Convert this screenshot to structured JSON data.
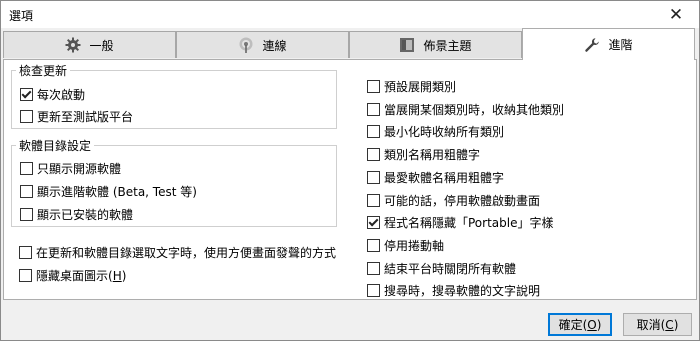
{
  "window": {
    "title": "選項",
    "close_label": "✕"
  },
  "tabs": [
    {
      "label": "一般",
      "icon": "gear-icon"
    },
    {
      "label": "連線",
      "icon": "antenna-icon"
    },
    {
      "label": "佈景主題",
      "icon": "theme-icon"
    },
    {
      "label": "進階",
      "icon": "wrench-icon",
      "active": true
    }
  ],
  "update_group": {
    "title": "檢查更新",
    "items": [
      {
        "label": "每次啟動",
        "checked": true
      },
      {
        "label": "更新至測試版平台",
        "checked": false
      }
    ]
  },
  "catalog_group": {
    "title": "軟體目錄設定",
    "items": [
      {
        "label": "只顯示開源軟體",
        "checked": false
      },
      {
        "label": "顯示進階軟體 (Beta, Test 等)",
        "checked": false
      },
      {
        "label": "顯示已安裝的軟體",
        "checked": false
      }
    ]
  },
  "misc_left": [
    {
      "label": "在更新和軟體目錄選取文字時，使用方便畫面發聲的方式",
      "checked": false
    },
    {
      "label_prefix": "隱藏桌面圖示(",
      "accel": "H",
      "label_suffix": ")",
      "checked": false
    }
  ],
  "right_options": [
    {
      "label": "預設展開類別",
      "checked": false
    },
    {
      "label": "當展開某個類別時，收納其他類別",
      "checked": false
    },
    {
      "label": "最小化時收納所有類別",
      "checked": false
    },
    {
      "label": "類別名稱用粗體字",
      "checked": false
    },
    {
      "label": "最愛軟體名稱用粗體字",
      "checked": false
    },
    {
      "label": "可能的話，停用軟體啟動畫面",
      "checked": false
    },
    {
      "label": "程式名稱隱藏「Portable」字樣",
      "checked": true
    },
    {
      "label": "停用捲動軸",
      "checked": false
    },
    {
      "label": "結束平台時關閉所有軟體",
      "checked": false
    },
    {
      "label": "搜尋時，搜尋軟體的文字說明",
      "checked": false
    }
  ],
  "buttons": {
    "ok": {
      "prefix": "確定(",
      "accel": "O",
      "suffix": ")"
    },
    "cancel": {
      "prefix": "取消(",
      "accel": "C",
      "suffix": ")"
    }
  },
  "colors": {
    "accent": "#0078d7",
    "tab_bg": "#e3e3e3",
    "panel_bg": "#ffffff"
  }
}
